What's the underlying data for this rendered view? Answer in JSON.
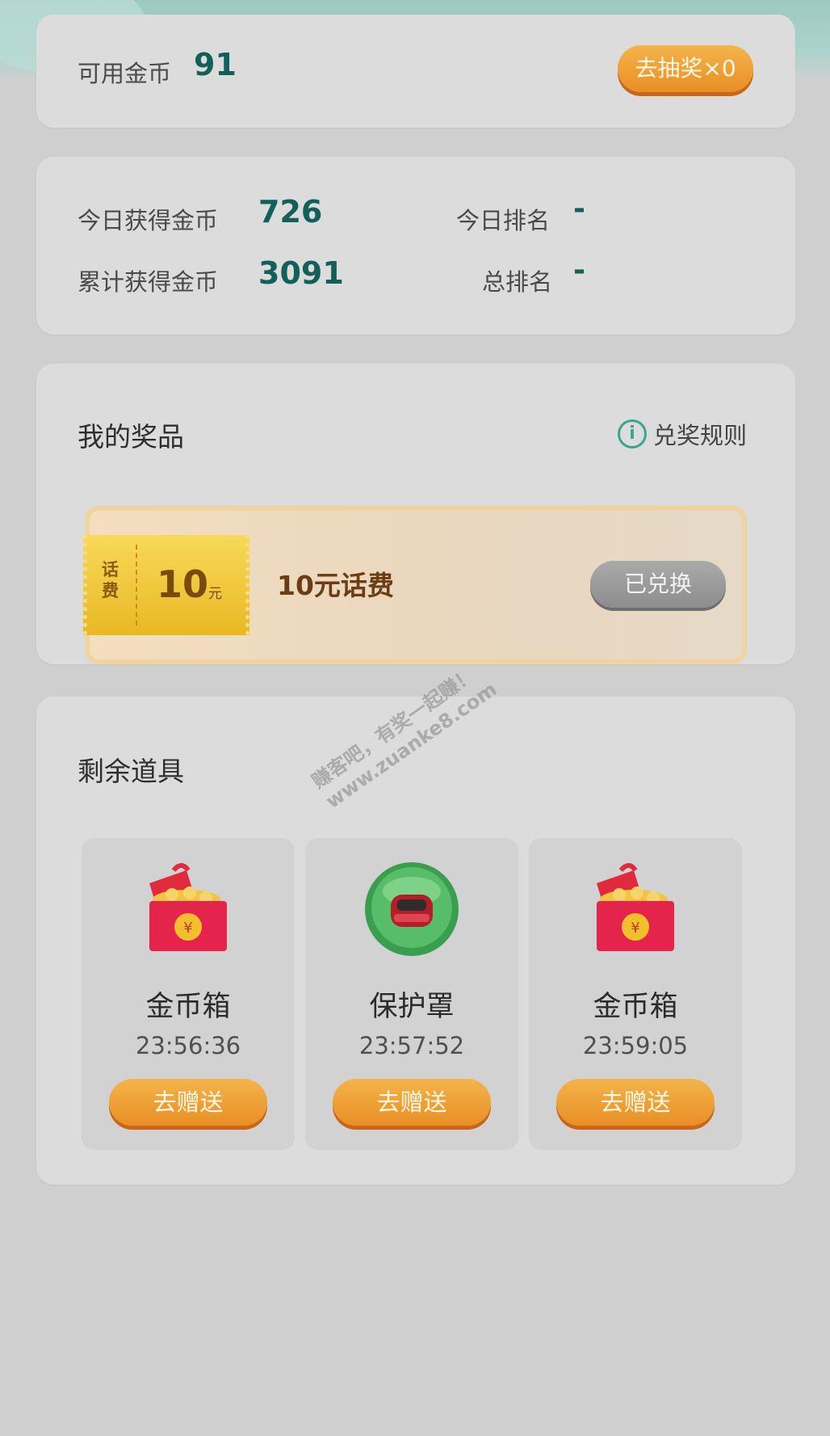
{
  "coins": {
    "available_label": "可用金币",
    "available_value": "91",
    "draw_button": "去抽奖×0"
  },
  "stats": {
    "today_label": "今日获得金币",
    "today_value": "726",
    "today_rank_label": "今日排名",
    "today_rank_value": "-",
    "total_label": "累计获得金币",
    "total_value": "3091",
    "total_rank_label": "总排名",
    "total_rank_value": "-"
  },
  "prizes": {
    "title": "我的奖品",
    "rules_link": "兑奖规则",
    "items": [
      {
        "ticket_tag": "话费",
        "ticket_amount": "10",
        "ticket_unit": "元",
        "name": "10元话费",
        "status_button": "已兑换"
      }
    ]
  },
  "props": {
    "title": "剩余道具",
    "items": [
      {
        "icon": "coin-box-icon",
        "name": "金币箱",
        "time": "23:56:36",
        "button": "去赠送"
      },
      {
        "icon": "shield-car-icon",
        "name": "保护罩",
        "time": "23:57:52",
        "button": "去赠送"
      },
      {
        "icon": "coin-box-icon",
        "name": "金币箱",
        "time": "23:59:05",
        "button": "去赠送"
      }
    ]
  },
  "watermark": {
    "line1": "赚客吧，有奖一起赚！",
    "line2": "www.zuanke8.com"
  },
  "colors": {
    "accent": "#13605a",
    "button_orange": "#ec9a2c",
    "card_bg": "#dcdcdc",
    "page_bg": "#cfcfcf"
  }
}
